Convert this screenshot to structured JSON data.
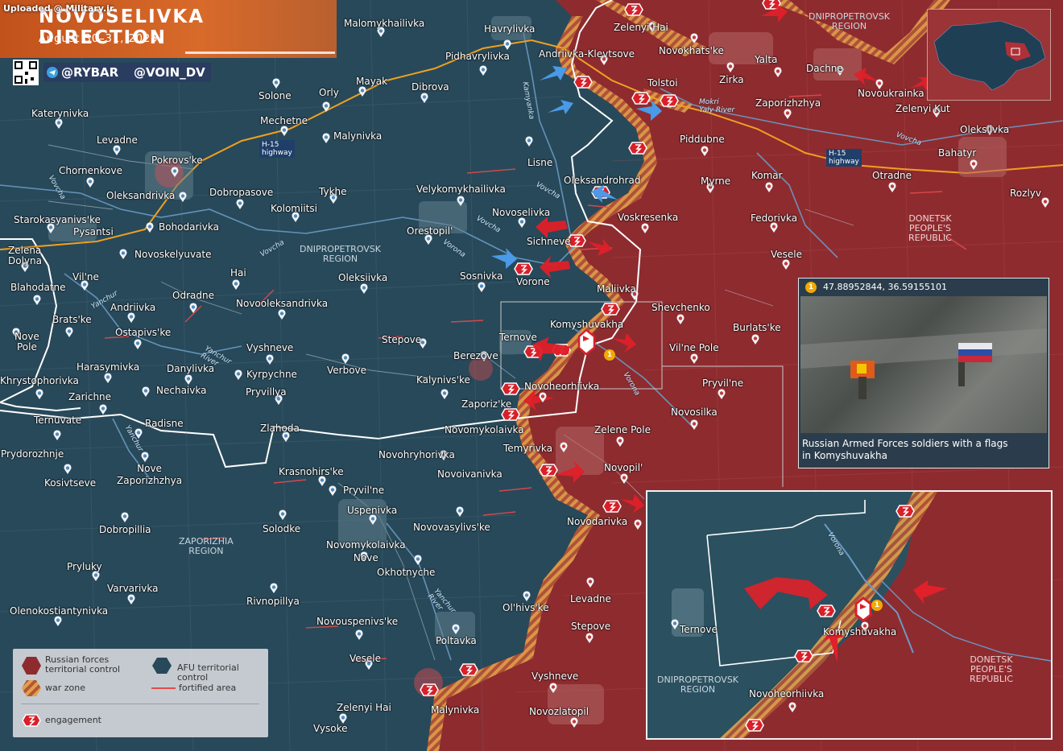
{
  "header": {
    "uploaded": "Uploaded @ Military.ir",
    "title": "NOVOSELIVKA DIRECTION",
    "date": "August 30–31, 2025",
    "handles": [
      "@RYBAR",
      "@VOIN_DV"
    ]
  },
  "regions": {
    "dnipro_top": "DNIPROPETROVSK\nREGION",
    "dnipro_mid": "DNIPROPETROVSK\nREGION",
    "donetsk": "DONETSK\nPEOPLE'S\nREPUBLIC",
    "zaporizhia": "ZAPORIZHIA\nREGION",
    "inset_dnipro": "DNIPROPETROVSK\nREGION",
    "inset_donetsk": "DONETSK\nPEOPLE'S\nREPUBLIC"
  },
  "rivers": [
    "Kamyanka",
    "Mokri\nYaly River",
    "Vovcha",
    "Vovcha",
    "Vovcha",
    "Vovcha",
    "Vovcha",
    "Vorona",
    "Vorona",
    "Yanchur",
    "Yanchur\nRiver",
    "Yanchur",
    "Yanchur\nRiver",
    "Vorona"
  ],
  "highways": [
    "H-15\nhighway",
    "H-15\nhighway"
  ],
  "places": [
    "Malomykhailivka",
    "Havrylivka",
    "Zelenyi Hai",
    "Novokhats'ke",
    "Pidhavrylivka",
    "Andriivka-Klevtsove",
    "Mayak",
    "Dibrova",
    "Solone",
    "Orly",
    "Tolstoi",
    "Zirka",
    "Yalta",
    "Dachne",
    "Novoukrainka",
    "Zelenyi Kut",
    "Katerynivka",
    "Mechetne",
    "Malynivka",
    "Zaporizhzhya",
    "Oleksiivka",
    "Levadne",
    "Pokrovs'ke",
    "Piddubne",
    "Bahatyr",
    "Chornenkove",
    "Lisne",
    "Oleksandrohrad",
    "Komar",
    "Otradne",
    "Rozlyv",
    "Oleksandrivka",
    "Dobropasove",
    "Tykhe",
    "Velykomykhailivka",
    "Myrne",
    "Kolomiitsi",
    "Novoselivka",
    "Voskresenka",
    "Fedorivka",
    "Starokasyanivs'ke",
    "Pysantsi",
    "Bohodarivka",
    "Orestopil'",
    "Sichneve",
    "Zelena\nDolyna",
    "Novoskelyuvate",
    "Sosnivka",
    "Vorone",
    "Vesele",
    "Vil'ne",
    "Hai",
    "Oleksiivka",
    "Maliivka",
    "Blahodatne",
    "Odradne",
    "Novooleksandrivka",
    "Shevchenko",
    "Andriivka",
    "Brats'ke",
    "Komyshuvakha",
    "Burlats'ke",
    "Nove\nPole",
    "Ostapivs'ke",
    "Stepove",
    "Ternove",
    "Vil'ne Pole",
    "Vyshneve",
    "Berezove",
    "Harasymivka",
    "Danylivka",
    "Verbove",
    "Kalynivs'ke",
    "Kyrpychne",
    "Novoheorhiivka",
    "Pryvil'ne",
    "Khrystophorivka",
    "Nechaivka",
    "Pryvillya",
    "Zarichne",
    "Zaporiz'ke",
    "Novosilka",
    "Ternuvate",
    "Radisne",
    "Novomykolaivka",
    "Zlahoda",
    "Zelene Pole",
    "Prydorozhnje",
    "Novohryhorivka",
    "Temyrivka",
    "Kosivtseve",
    "Nove\nZaporizhzhya",
    "Krasnohirs'ke",
    "Novoivanivka",
    "Novopil'",
    "Pryvil'ne",
    "Uspenivka",
    "Dobropillia",
    "Solodke",
    "Novovasylivs'ke",
    "Novodarivka",
    "Novomykolaivka\nNove",
    "Pryluky",
    "Okhotnyche",
    "Levadne",
    "Varvarivka",
    "Rivnopillya",
    "Ol'hivs'ke",
    "Olenokostiantynivka",
    "Novouspenivs'ke",
    "Stepove",
    "Poltavka",
    "Vesele",
    "Vyshneve",
    "Zelenyi Hai",
    "Malynivka",
    "Novozlatopil",
    "Vysoke"
  ],
  "legend": {
    "russian": "Russian forces\nterritorial control",
    "afu": "AFU territorial control",
    "war_zone": "war zone",
    "fortified": "fortified area",
    "engagement": "engagement"
  },
  "photo": {
    "badge": "1",
    "coords": "47.88952844, 36.59155101",
    "caption_1": "Russian Armed Forces soldiers with a flags",
    "caption_2": "in Komyshuvakha"
  },
  "inset": {
    "places": [
      "Ternove",
      "Komyshuvakha",
      "Novoheorhiivka"
    ],
    "river": "Vorona",
    "badge": "1"
  },
  "colors": {
    "afu": "#28495a",
    "russian": "#8e2b2f",
    "war_zone": "#d89b3a",
    "header": "#d0602a",
    "engagement": "#d8202a"
  }
}
